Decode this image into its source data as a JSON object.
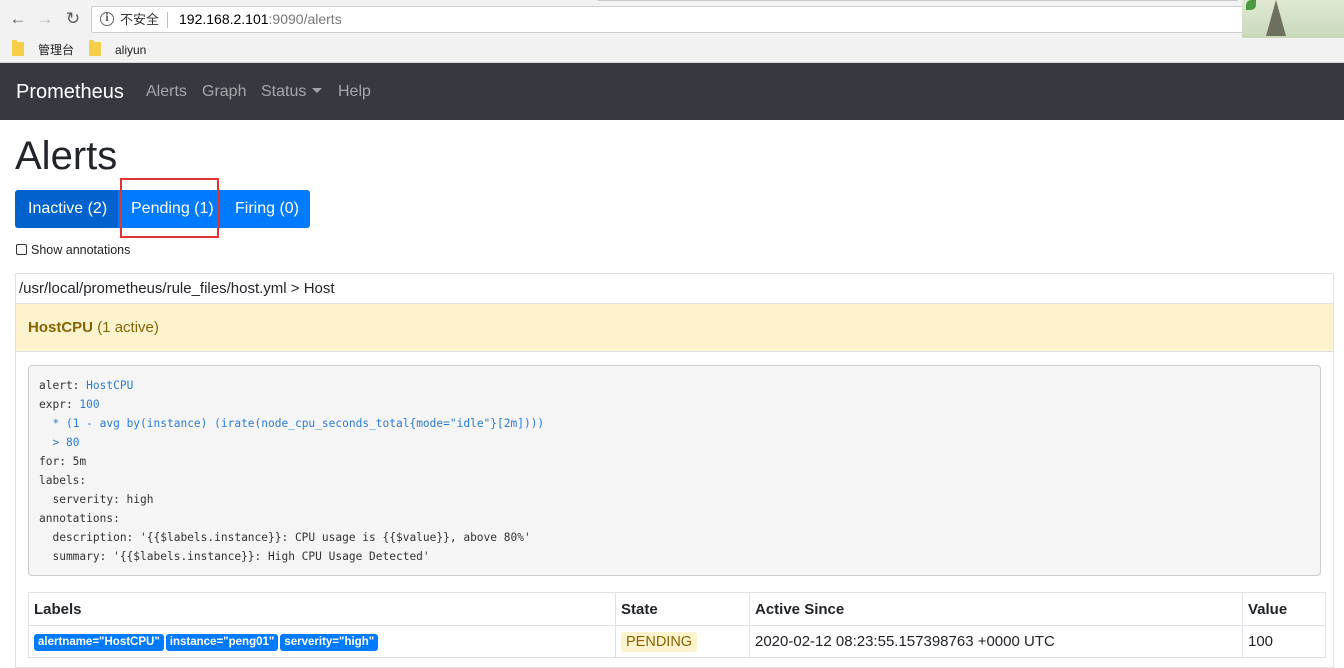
{
  "browser": {
    "security_label": "不安全",
    "url_host": "192.168.2.101",
    "url_rest": ":9090/alerts",
    "bookmarks": [
      "管理台",
      "aliyun"
    ]
  },
  "navbar": {
    "brand": "Prometheus",
    "links": [
      "Alerts",
      "Graph",
      "Status",
      "Help"
    ]
  },
  "page": {
    "title": "Alerts",
    "filters": {
      "inactive": "Inactive (2)",
      "pending": "Pending (1)",
      "firing": "Firing (0)"
    },
    "show_annotations": "Show annotations"
  },
  "rule_group": {
    "file": "/usr/local/prometheus/rule_files/host.yml > Host",
    "alert_name": "HostCPU",
    "alert_active": "(1 active)",
    "rule_yaml": [
      {
        "key": "alert: ",
        "value": "HostCPU"
      },
      {
        "key": "expr: ",
        "value": "100"
      },
      {
        "key": "  ",
        "value": "* (1 - avg by(instance) (irate(node_cpu_seconds_total{mode=\"idle\"}[2m])))"
      },
      {
        "key": "  ",
        "value": "> 80"
      },
      {
        "key": "for: 5m",
        "value": ""
      },
      {
        "key": "labels:",
        "value": ""
      },
      {
        "key": "  serverity: high",
        "value": ""
      },
      {
        "key": "annotations:",
        "value": ""
      },
      {
        "key": "  description: '{{$labels.instance}}: CPU usage is {{$value}}, above 80%'",
        "value": ""
      },
      {
        "key": "  summary: '{{$labels.instance}}: High CPU Usage Detected'",
        "value": ""
      }
    ]
  },
  "alerts_table": {
    "headers": [
      "Labels",
      "State",
      "Active Since",
      "Value"
    ],
    "rows": [
      {
        "labels": [
          "alertname=\"HostCPU\"",
          "instance=\"peng01\"",
          "serverity=\"high\""
        ],
        "state": "PENDING",
        "active_since": "2020-02-12 08:23:55.157398763 +0000 UTC",
        "value": "100"
      }
    ]
  },
  "colors": {
    "navbar_bg": "#343a40",
    "primary": "#007bff",
    "primary_active": "#0062cc",
    "warning_bg": "#fff3cd",
    "warning_text": "#856404",
    "highlight_border": "#e0342f"
  }
}
